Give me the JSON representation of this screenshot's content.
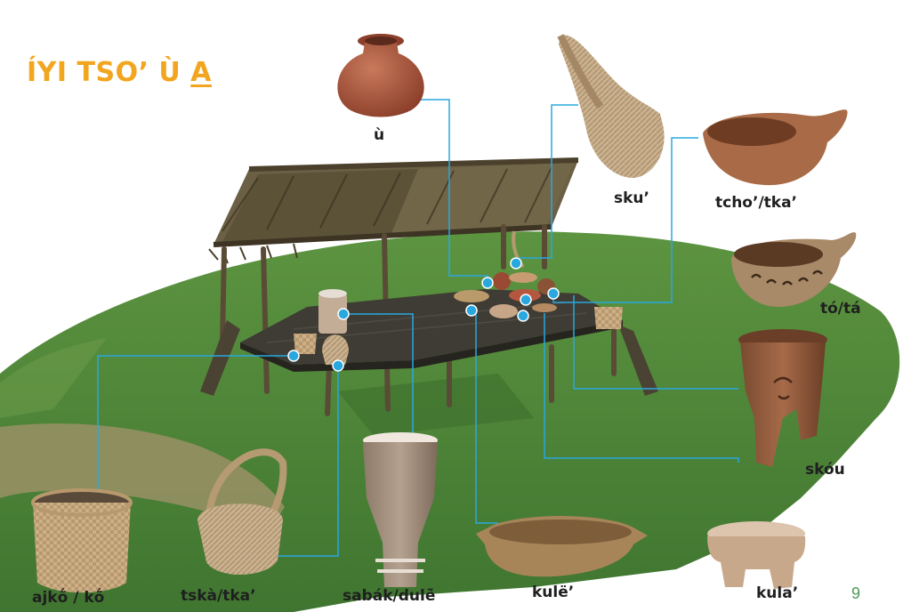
{
  "title": {
    "main": "ÍYI TSO’ Ù ",
    "underlined": "A"
  },
  "page_number": "9",
  "labels": {
    "u": "ù",
    "sku": "sku’",
    "tcho": "tcho’/tka’",
    "to": "tó/tá",
    "skou": "skóu",
    "kula": "kula’",
    "kule": "kulë’",
    "sabak": "sabák/dulẽ̀",
    "tska": "tskà/tka’",
    "ajko": "ajkṍ / kṍ"
  },
  "colors": {
    "title": "#f2a51f",
    "leader_line": "#29a8e0",
    "grass": "#4f8a3a",
    "page_number": "#4f9b57"
  }
}
